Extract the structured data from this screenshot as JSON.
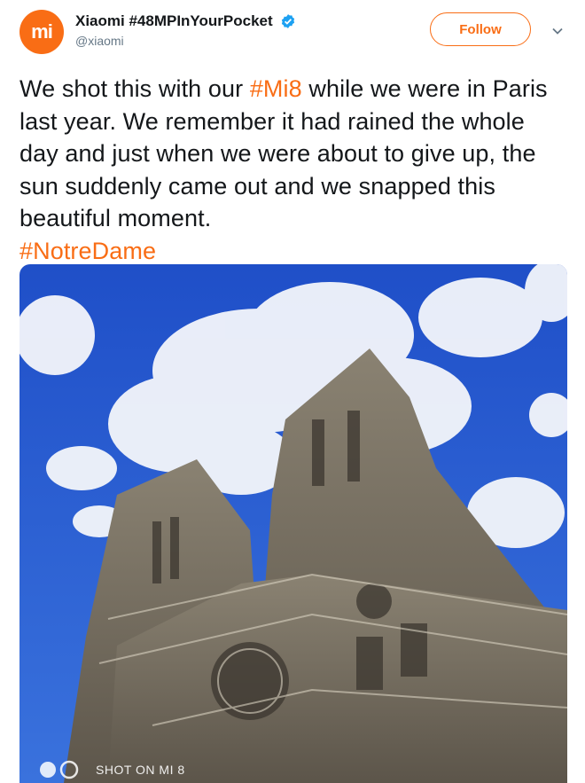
{
  "account": {
    "avatar_text": "mi",
    "display_name": "Xiaomi #48MPInYourPocket",
    "handle": "@xiaomi",
    "verified": true
  },
  "follow_button": {
    "label": "Follow"
  },
  "menu": {
    "icon": "chevron-down-icon"
  },
  "tweet": {
    "text_part1": "We shot this with our ",
    "hashtag1": "#Mi8",
    "text_part2": " while we were in Paris last year. We remember it had rained the whole day and just when we were about to give up, the sun suddenly came out and we snapped this beautiful moment.",
    "hashtag2": "#NotreDame"
  },
  "photo": {
    "watermark": "SHOT ON MI 8"
  },
  "colors": {
    "brand": "#f96d15",
    "verified": "#1da1f2",
    "sky": "#2f5fd0"
  }
}
